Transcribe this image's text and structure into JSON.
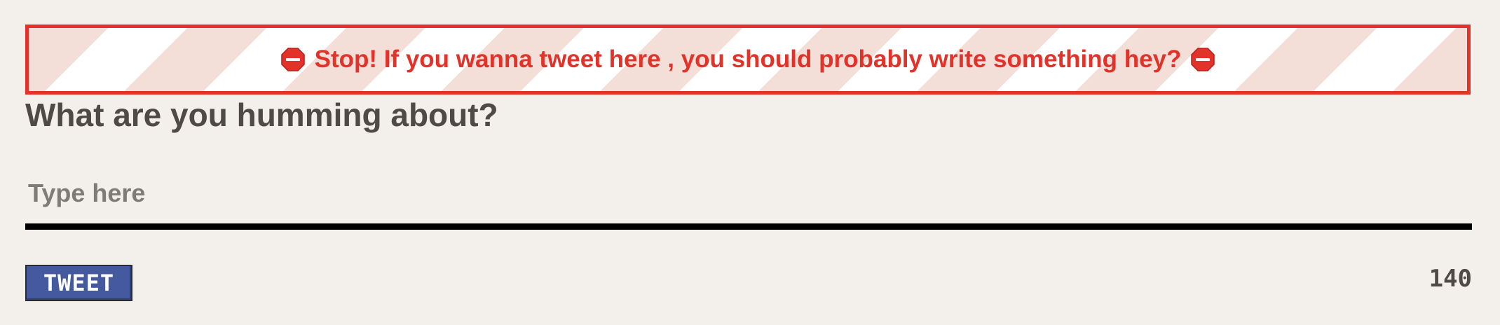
{
  "alert": {
    "message": "Stop! If you wanna tweet here , you should probably write something hey?",
    "icon": "stop-sign-icon",
    "color": "#e2332a"
  },
  "composer": {
    "heading": "What are you humming about?",
    "placeholder": "Type here",
    "value": ""
  },
  "actions": {
    "tweet_label": "TWEET",
    "button_color": "#44599e"
  },
  "counter": {
    "remaining": "140"
  }
}
